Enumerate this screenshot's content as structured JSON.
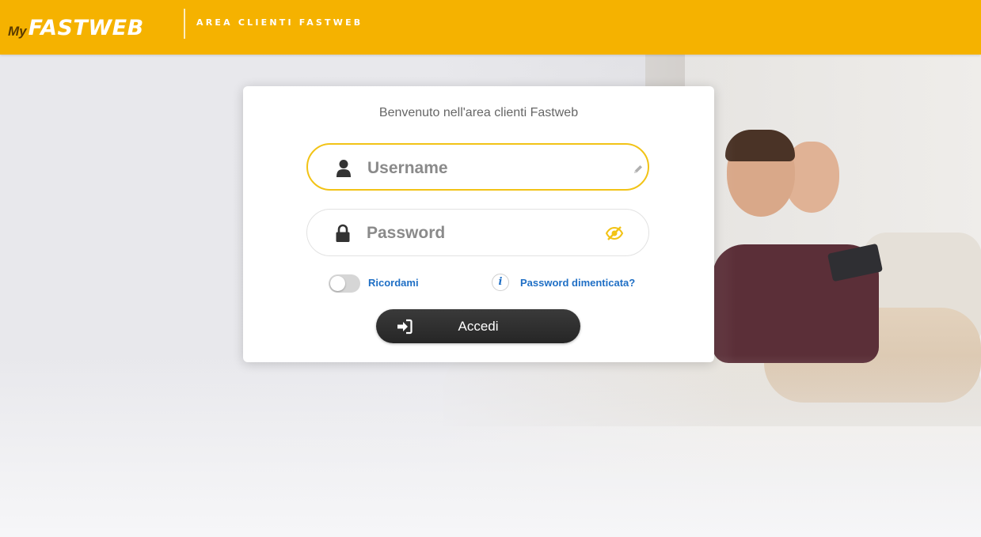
{
  "header": {
    "logo_prefix": "My",
    "logo_brand": "FASTWEB",
    "subtitle": "AREA CLIENTI FASTWEB",
    "background_color": "#f5b200"
  },
  "login": {
    "title": "Benvenuto nell'area clienti Fastweb",
    "username": {
      "value": "",
      "placeholder": "Username",
      "icon": "user-icon",
      "action_icon": "pencil-icon"
    },
    "password": {
      "value": "",
      "placeholder": "Password",
      "icon": "lock-icon",
      "action_icon": "eye-slash-icon"
    },
    "remember_me": {
      "label": "Ricordami",
      "checked": false
    },
    "forgot_password": {
      "label": "Password dimenticata?",
      "icon": "info-icon"
    },
    "submit": {
      "label": "Accedi",
      "icon": "sign-in-icon"
    }
  },
  "colors": {
    "accent_yellow": "#f2c316",
    "link_blue": "#1f6fc5",
    "button_dark": "#2e2e2e"
  }
}
